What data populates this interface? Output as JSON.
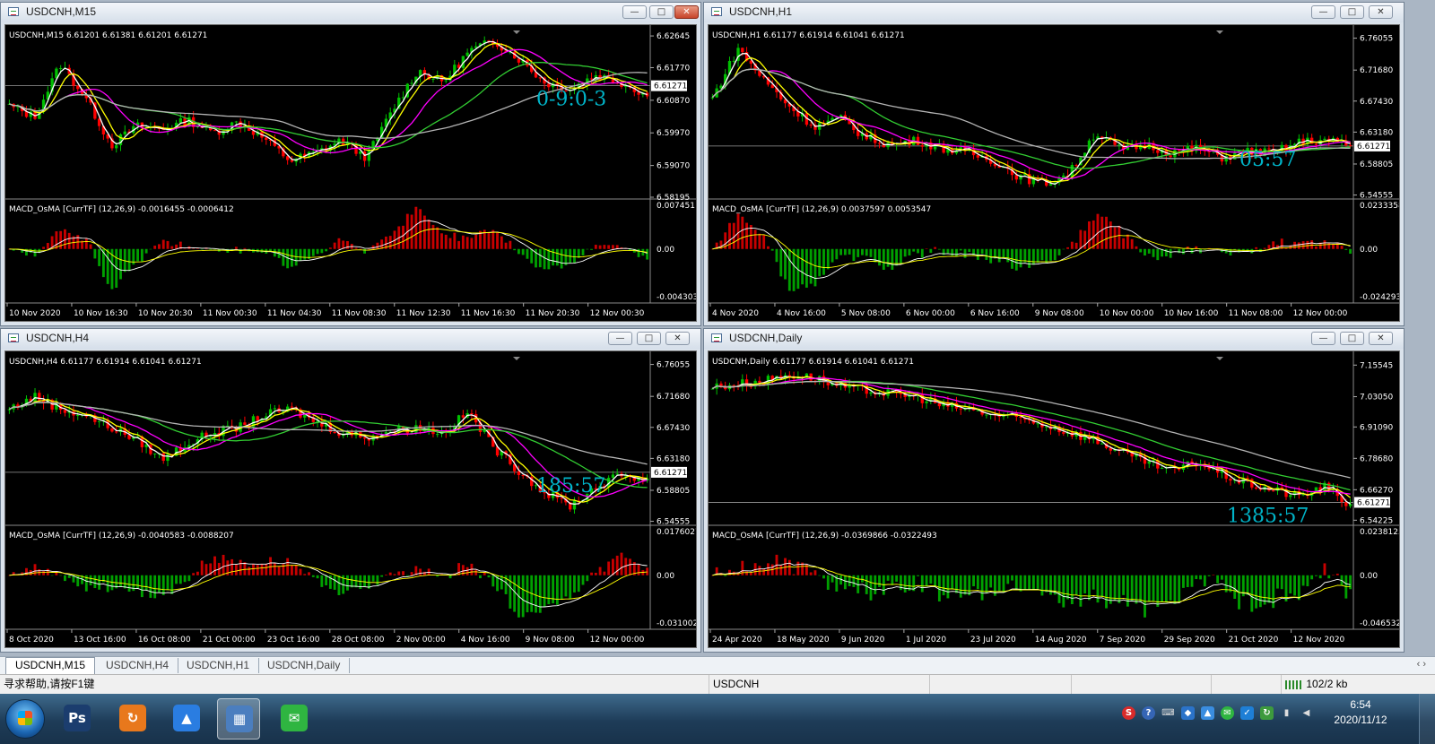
{
  "windows": [
    {
      "title": "USDCNH,M15",
      "close_red": true,
      "header": "USDCNH,M15  6.61201 6.61381 6.61201 6.61271",
      "price_ticks": [
        "6.62645",
        "6.61770",
        "6.60870",
        "6.59970",
        "6.59070",
        "6.58195"
      ],
      "price_ticks_values": [
        6.62645,
        6.6177,
        6.6087,
        6.5997,
        6.5907,
        6.58195
      ],
      "current_price": "6.61271",
      "current_value": 6.61271,
      "ylim": [
        6.58195,
        6.62845
      ],
      "countdown": "0-9:0-3",
      "macd_label": "MACD_OsMA [CurrTF] (12,26,9) -0.0016455 -0.0006412",
      "macd_ticks": [
        "0.007451",
        "0.00",
        "-0.004303"
      ],
      "time_ticks": [
        "10 Nov 2020",
        "10 Nov 16:30",
        "10 Nov 20:30",
        "11 Nov 00:30",
        "11 Nov 04:30",
        "11 Nov 08:30",
        "11 Nov 12:30",
        "11 Nov 16:30",
        "11 Nov 20:30",
        "12 Nov 00:30"
      ],
      "path": [
        0.55,
        0.48,
        0.82,
        0.6,
        0.3,
        0.42,
        0.4,
        0.46,
        0.38,
        0.45,
        0.34,
        0.2,
        0.25,
        0.33,
        0.22,
        0.52,
        0.78,
        0.7,
        0.9,
        0.97,
        0.85,
        0.7,
        0.66,
        0.75,
        0.7,
        0.62
      ]
    },
    {
      "title": "USDCNH,H1",
      "close_red": false,
      "header": "USDCNH,H1  6.61177 6.61914 6.61041 6.61271",
      "price_ticks": [
        "6.76055",
        "6.71680",
        "6.67430",
        "6.63180",
        "6.58805",
        "6.54555"
      ],
      "price_ticks_values": [
        6.76055,
        6.7168,
        6.6743,
        6.6318,
        6.58805,
        6.54555
      ],
      "current_price": "6.61271",
      "current_value": 6.61271,
      "ylim": [
        6.54255,
        6.77355
      ],
      "countdown": "05:57",
      "macd_label": "MACD_OsMA [CurrTF] (12,26,9) 0.0037597 0.0053547",
      "macd_ticks": [
        "0.0233358",
        "0.00",
        "-0.0242936"
      ],
      "time_ticks": [
        "4 Nov 2020",
        "4 Nov 16:00",
        "5 Nov 08:00",
        "6 Nov 00:00",
        "6 Nov 16:00",
        "9 Nov 08:00",
        "10 Nov 00:00",
        "10 Nov 16:00",
        "11 Nov 08:00",
        "12 Nov 00:00"
      ],
      "path": [
        0.6,
        0.92,
        0.72,
        0.55,
        0.42,
        0.47,
        0.35,
        0.3,
        0.33,
        0.28,
        0.25,
        0.2,
        0.1,
        0.05,
        0.12,
        0.38,
        0.27,
        0.3,
        0.25,
        0.28,
        0.22,
        0.26,
        0.25,
        0.32,
        0.33,
        0.3
      ]
    },
    {
      "title": "USDCNH,H4",
      "close_red": false,
      "header": "USDCNH,H4  6.61177 6.61914 6.61041 6.61271",
      "price_ticks": [
        "6.76055",
        "6.71680",
        "6.67430",
        "6.63180",
        "6.58805",
        "6.54555"
      ],
      "price_ticks_values": [
        6.76055,
        6.7168,
        6.6743,
        6.6318,
        6.58805,
        6.54555
      ],
      "current_price": "6.61271",
      "current_value": 6.61271,
      "ylim": [
        6.54255,
        6.77355
      ],
      "countdown": "185:57",
      "macd_label": "MACD_OsMA [CurrTF] (12,26,9) -0.0040583 -0.0088207",
      "macd_ticks": [
        "0.0176027",
        "0.00",
        "-0.031002"
      ],
      "time_ticks": [
        "8 Oct 2020",
        "13 Oct 16:00",
        "16 Oct 08:00",
        "21 Oct 00:00",
        "23 Oct 16:00",
        "28 Oct 08:00",
        "2 Nov 00:00",
        "4 Nov 16:00",
        "9 Nov 08:00",
        "12 Nov 00:00"
      ],
      "path": [
        0.7,
        0.78,
        0.7,
        0.66,
        0.58,
        0.5,
        0.38,
        0.48,
        0.55,
        0.58,
        0.66,
        0.7,
        0.62,
        0.55,
        0.52,
        0.56,
        0.58,
        0.55,
        0.68,
        0.45,
        0.3,
        0.16,
        0.08,
        0.2,
        0.28,
        0.25
      ]
    },
    {
      "title": "USDCNH,Daily",
      "close_red": false,
      "header": "USDCNH,Daily  6.61177 6.61914 6.61041 6.61271",
      "price_ticks": [
        "7.15545",
        "7.03050",
        "6.91090",
        "6.78680",
        "6.66270",
        "6.54225"
      ],
      "price_ticks_values": [
        7.15545,
        7.0305,
        6.9109,
        6.7868,
        6.6627,
        6.54225
      ],
      "current_price": "6.61271",
      "current_value": 6.61271,
      "ylim": [
        6.52925,
        7.19545
      ],
      "countdown": "1385:57",
      "macd_label": "MACD_OsMA [CurrTF] (12,26,9) -0.0369866 -0.0322493",
      "macd_ticks": [
        "0.0238125",
        "0.00",
        "-0.046532"
      ],
      "time_ticks": [
        "24 Apr 2020",
        "18 May 2020",
        "9 Jun 2020",
        "1 Jul 2020",
        "23 Jul 2020",
        "14 Aug 2020",
        "7 Sep 2020",
        "29 Sep 2020",
        "21 Oct 2020",
        "12 Nov 2020"
      ],
      "path": [
        0.84,
        0.86,
        0.88,
        0.92,
        0.9,
        0.84,
        0.82,
        0.8,
        0.78,
        0.72,
        0.7,
        0.66,
        0.64,
        0.6,
        0.55,
        0.5,
        0.42,
        0.36,
        0.3,
        0.36,
        0.28,
        0.22,
        0.18,
        0.14,
        0.2,
        0.08
      ]
    }
  ],
  "tabs": [
    "USDCNH,M15",
    "USDCNH,H4",
    "USDCNH,H1",
    "USDCNH,Daily"
  ],
  "tab_arrows": "‹ ›",
  "status": {
    "help": "寻求帮助,请按F1键",
    "symbol": "USDCNH",
    "traffic": "102/2 kb"
  },
  "taskbar": {
    "time": "6:54",
    "date": "2020/11/12",
    "apps": [
      {
        "name": "photoshop",
        "glyph": "Ps",
        "color": "#1b3d6e"
      },
      {
        "name": "browser",
        "glyph": "↻",
        "color": "#e8781c"
      },
      {
        "name": "meeting",
        "glyph": "▲",
        "color": "#2a7de1"
      },
      {
        "name": "metatrader",
        "glyph": "▦",
        "color": "#4b7ebf"
      },
      {
        "name": "wechat",
        "glyph": "✉",
        "color": "#2fb541"
      }
    ]
  },
  "colors": {
    "bull": "#00c000",
    "bear": "#ff0000",
    "ma_white": "#ffffff",
    "ma_yellow": "#ffff00",
    "ma_magenta": "#ff00ff",
    "ma_green": "#32cd32",
    "ma_gray": "#b4b4b4",
    "countdown": "#00b4c8",
    "hist_pos": "#c80000",
    "hist_neg": "#00a000"
  }
}
